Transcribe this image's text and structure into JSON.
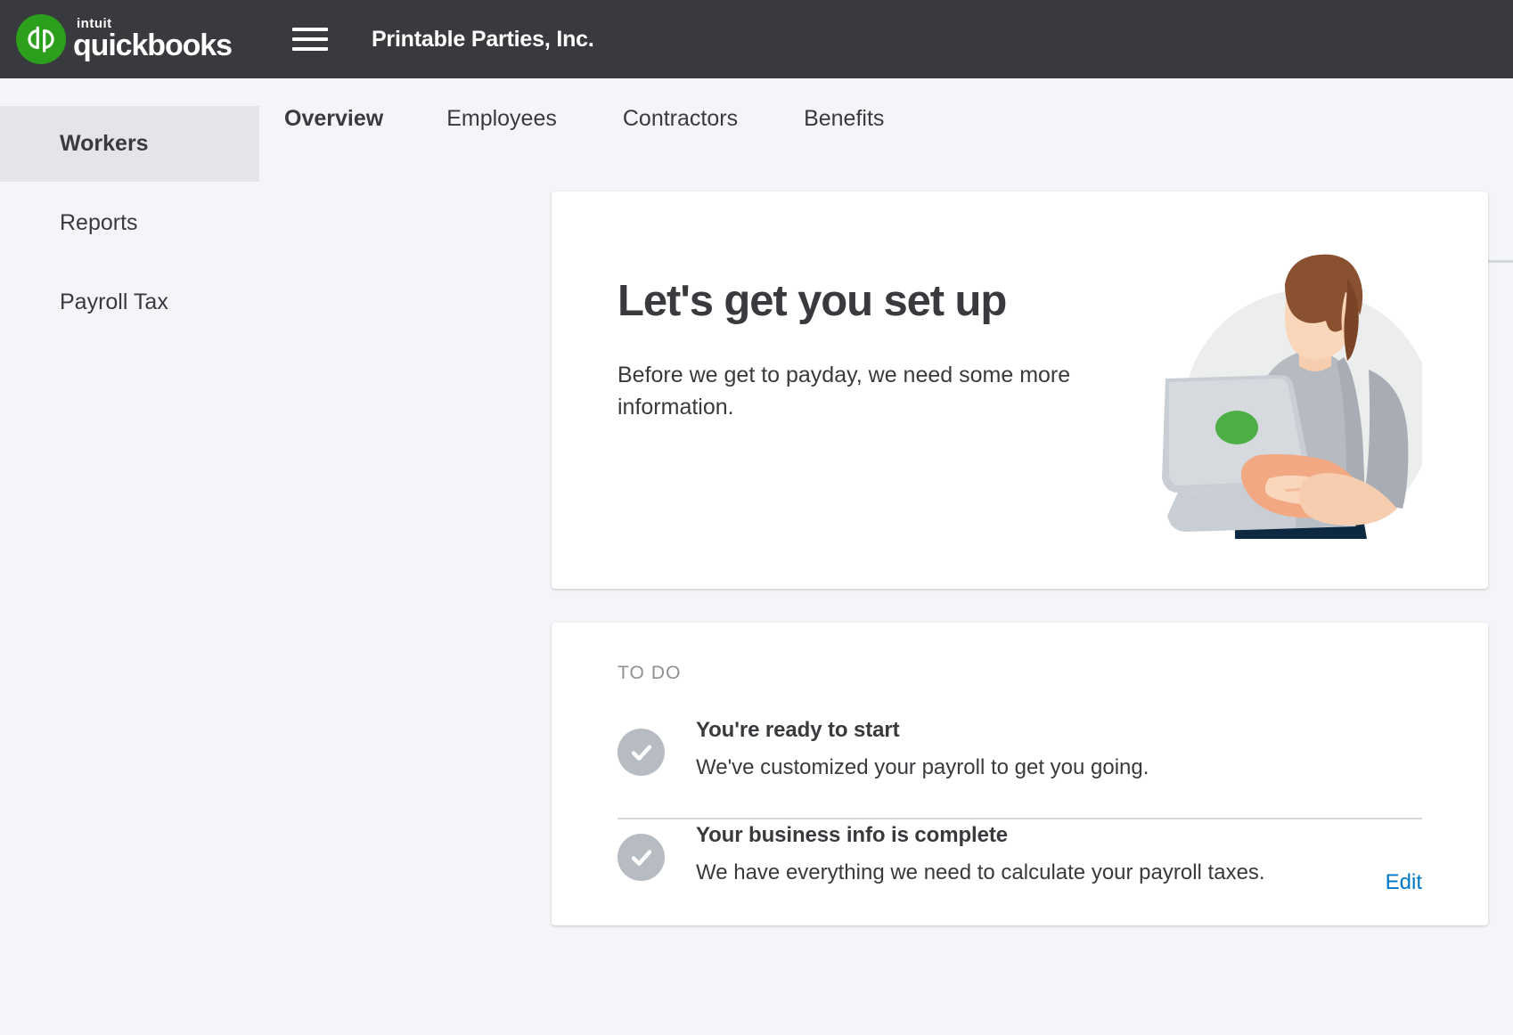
{
  "colors": {
    "brand_green": "#2ca01c",
    "topbar_bg": "#393a3d",
    "page_bg": "#f4f5f8",
    "link_blue": "#0077c5",
    "muted_text": "#8d9096",
    "check_circle": "#b7bbc2",
    "divider": "#d4d7dc"
  },
  "topbar": {
    "logo_intuit": "intuit",
    "logo_product": "quickbooks",
    "logo_mark_name": "quickbooks-qb-logo-icon",
    "menu_icon": "hamburger-menu-icon",
    "company_name": "Printable Parties, Inc."
  },
  "sidebar": {
    "items": [
      {
        "label": "Workers",
        "active": true
      },
      {
        "label": "Reports",
        "active": false
      },
      {
        "label": "Payroll Tax",
        "active": false
      }
    ]
  },
  "main": {
    "tabs": [
      {
        "label": "Overview",
        "active": true
      },
      {
        "label": "Employees",
        "active": false
      },
      {
        "label": "Contractors",
        "active": false
      },
      {
        "label": "Benefits",
        "active": false
      }
    ],
    "hero": {
      "title": "Let's get you set up",
      "subtitle": "Before we get to payday, we need some more information.",
      "illustration_name": "person-with-laptop-illustration"
    },
    "todo": {
      "section_label": "TO DO",
      "items": [
        {
          "title": "You're ready to start",
          "description": "We've customized your payroll to get you going.",
          "status_icon": "check-circle-icon",
          "action": ""
        },
        {
          "title": "Your business info is complete",
          "description": "We have everything we need to calculate your payroll taxes.",
          "status_icon": "check-circle-icon",
          "action": "Edit"
        }
      ]
    }
  }
}
